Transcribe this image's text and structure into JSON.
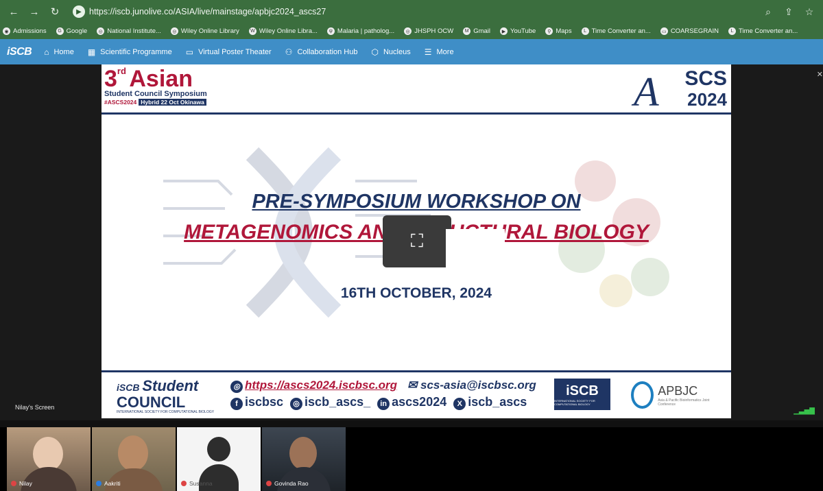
{
  "browser": {
    "url": "https://iscb.junolive.co/ASIA/live/mainstage/apbjc2024_ascs27",
    "bookmarks": [
      "Admissions",
      "Google",
      "National Institute...",
      "Wiley Online Library",
      "Wiley Online Libra...",
      "Malaria | patholog...",
      "JHSPH OCW",
      "Gmail",
      "YouTube",
      "Maps",
      "Time Converter an...",
      "COARSEGRAIN",
      "Time Converter an..."
    ]
  },
  "nav": {
    "logo": "iSCB",
    "items": [
      "Home",
      "Scientific Programme",
      "Virtual Poster Theater",
      "Collaboration Hub",
      "Nucleus",
      "More"
    ]
  },
  "slide": {
    "big3": "3",
    "sup": "rd",
    "asian": "Asian",
    "subtitle": "Student Council Symposium",
    "tag1": "#ASCS2024",
    "tag2": "Hybrid 22 Oct Okinawa",
    "ascs": "SCS",
    "year": "2024",
    "title_line1": "PRE-SYMPOSIUM WORKSHOP ON",
    "title_line2": "METAGENOMICS AND STRUCTURAL BIOLOGY",
    "date": "16TH OCTOBER, 2024",
    "footer": {
      "student": "Student",
      "council": "COUNCIL",
      "org_small": "INTERNATIONAL SOCIETY FOR COMPUTATIONAL BIOLOGY",
      "link": "https://ascs2024.iscbsc.org",
      "email": "scs-asia@iscbsc.org",
      "facebook": "iscbsc",
      "instagram": "iscb_ascs_",
      "linkedin": "ascs2024",
      "x": "iscb_ascs",
      "iscb": "iSCB",
      "iscb_small": "INTERNATIONAL SOCIETY FOR COMPUTATIONAL BIOLOGY",
      "apbjc": "APBJC",
      "apbjc_small": "Asia & Pacific Bioinformatics Joint Conference"
    }
  },
  "screen_label": "Nilay's Screen",
  "participants": [
    "Nilay",
    "Aakriti",
    "Susanna",
    "Govinda Rao"
  ]
}
